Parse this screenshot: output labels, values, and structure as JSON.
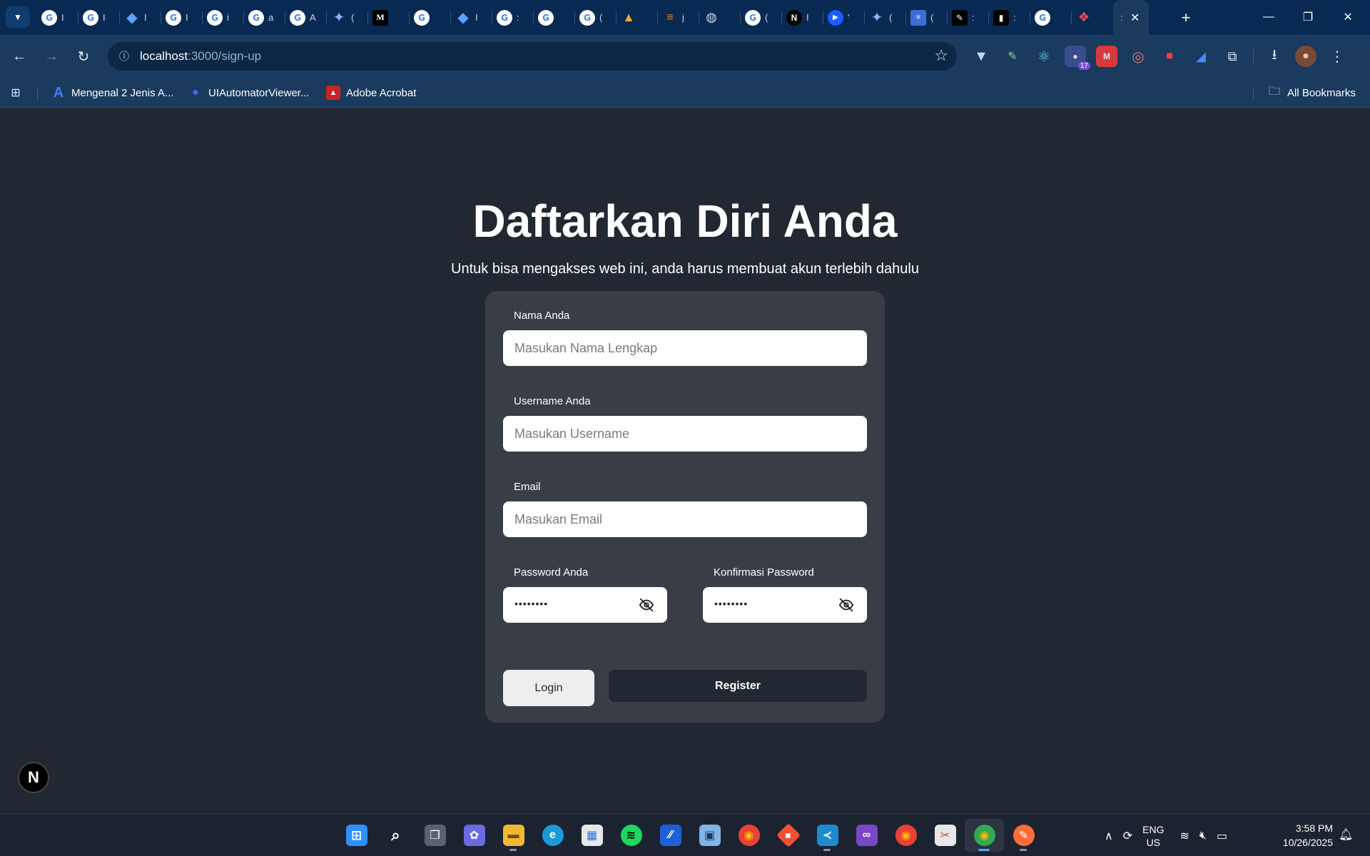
{
  "browser": {
    "tab_letters": [
      "I",
      "I",
      "I",
      "I",
      "i",
      "a",
      "A",
      "(",
      "",
      "",
      "I",
      ":",
      "",
      "(",
      "",
      "j",
      "",
      "(",
      "I",
      "'",
      "(",
      "(",
      ":",
      ":",
      "",
      "",
      ":"
    ],
    "close_glyph": "✕",
    "new_tab_glyph": "+",
    "window": {
      "minimize": "—",
      "restore": "❐",
      "close": "✕"
    },
    "url_host": "localhost",
    "url_path": ":3000/sign-up",
    "extension_badge": "17"
  },
  "bookmarks": {
    "items": [
      {
        "label": "Mengenal 2 Jenis A...",
        "icon": "A"
      },
      {
        "label": "UIAutomatorViewer...",
        "icon": "●"
      },
      {
        "label": "Adobe Acrobat",
        "icon": "▲"
      }
    ],
    "all_bookmarks": "All Bookmarks"
  },
  "page": {
    "title": "Daftarkan Diri Anda",
    "subtitle": "Untuk bisa mengakses web ini, anda harus membuat akun terlebih dahulu",
    "fields": {
      "name": {
        "label": "Nama Anda",
        "placeholder": "Masukan Nama Lengkap"
      },
      "username": {
        "label": "Username Anda",
        "placeholder": "Masukan Username"
      },
      "email": {
        "label": "Email",
        "placeholder": "Masukan Email"
      },
      "password": {
        "label": "Password Anda",
        "value": "••••••••"
      },
      "confirm_password": {
        "label": "Konfirmasi Password",
        "value": "••••••••"
      }
    },
    "login_label": "Login",
    "register_label": "Register",
    "next_badge": "N"
  },
  "taskbar": {
    "lang_line1": "ENG",
    "lang_line2": "US",
    "time": "3:58 PM",
    "date": "10/26/2025"
  },
  "colors": {
    "page_bg": "#222831",
    "card_bg": "#393e46",
    "register_bg": "#222831",
    "login_bg": "#eeeeee",
    "tabstrip_bg": "#082a52",
    "toolbar_bg": "#1a3a5e"
  }
}
